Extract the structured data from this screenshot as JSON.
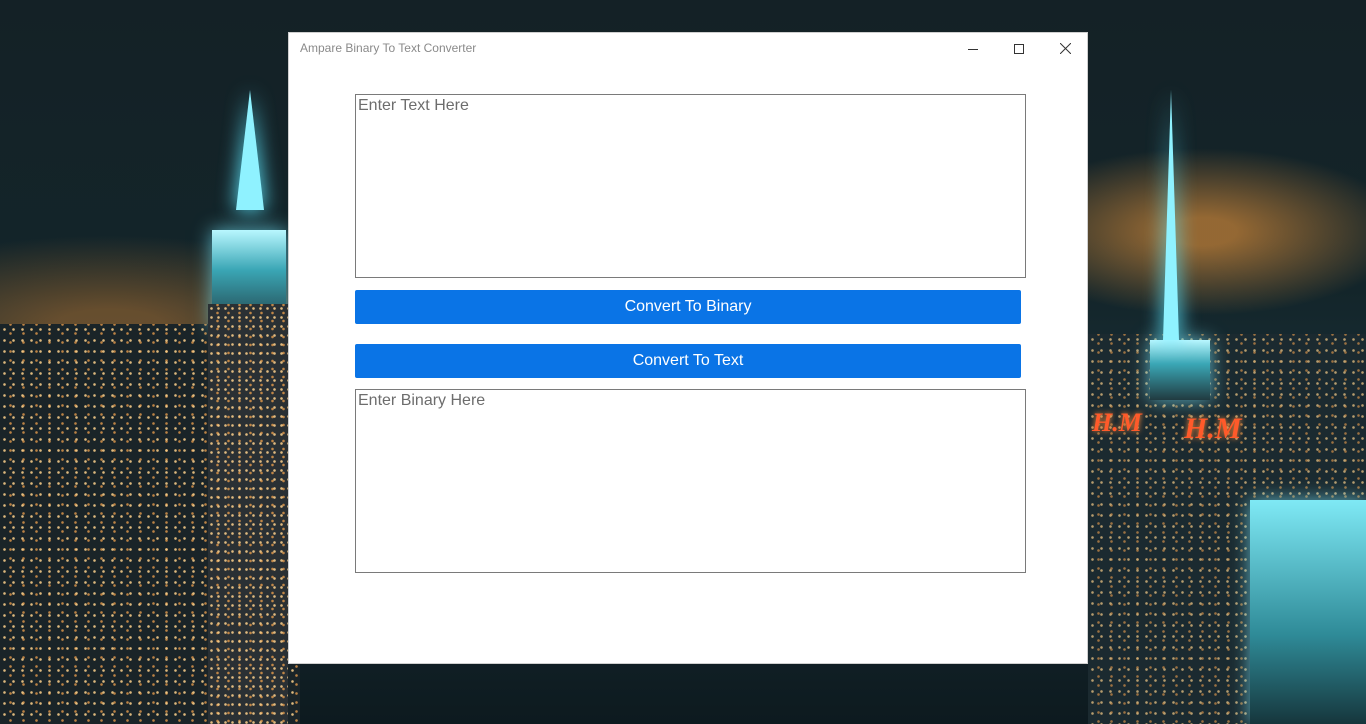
{
  "window": {
    "title": "Ampare Binary To Text Converter",
    "controls": {
      "minimize_icon": "minimize-icon",
      "maximize_icon": "maximize-icon",
      "close_icon": "close-icon"
    }
  },
  "text_input": {
    "value": "",
    "placeholder": "Enter Text Here"
  },
  "buttons": {
    "convert_to_binary": "Convert To Binary",
    "convert_to_text": "Convert To Text"
  },
  "binary_input": {
    "value": "",
    "placeholder": "Enter Binary Here"
  },
  "colors": {
    "button": "#0a74e6",
    "button_text": "#ffffff",
    "window_bg": "#ffffff"
  },
  "wallpaper": {
    "signs": [
      "H.M",
      "H.M"
    ]
  }
}
